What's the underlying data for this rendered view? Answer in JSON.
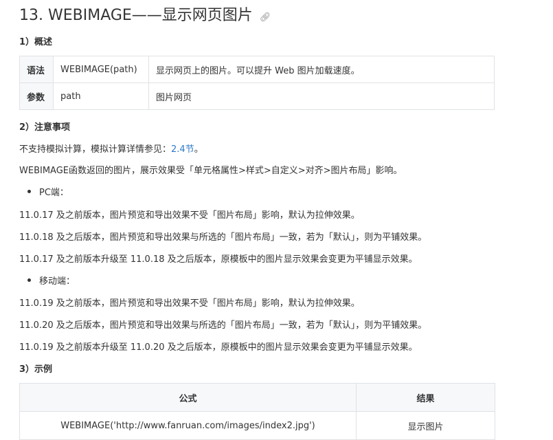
{
  "title": "13. WEBIMAGE——显示网页图片",
  "anchor_icon": "link-icon",
  "section1": {
    "heading": "1）概述",
    "rows": [
      {
        "key": "语法",
        "value": "WEBIMAGE(path)",
        "desc": "显示网页上的图片。可以提升 Web 图片加载速度。"
      },
      {
        "key": "参数",
        "value": "path",
        "desc": "图片网页"
      }
    ]
  },
  "section2": {
    "heading": "2）注意事项",
    "p1_text": "不支持模拟计算，模拟计算详情参见：",
    "p1_link": "2.4节",
    "p1_end": "。",
    "p2": "WEBIMAGE函数返回的图片，展示效果受「单元格属性>样式>自定义>对齐>图片布局」影响。",
    "pc_label": "PC端：",
    "pc_lines": [
      "11.0.17 及之前版本，图片预览和导出效果不受「图片布局」影响，默认为拉伸效果。",
      "11.0.18 及之后版本，图片预览和导出效果与所选的「图片布局」一致，若为「默认」，则为平铺效果。",
      "11.0.17 及之前版本升级至 11.0.18 及之后版本，原模板中的图片显示效果会变更为平铺显示效果。"
    ],
    "mobile_label": "移动端：",
    "mobile_lines": [
      "11.0.19 及之前版本，图片预览和导出效果不受「图片布局」影响，默认为拉伸效果。",
      "11.0.20 及之后版本，图片预览和导出效果与所选的「图片布局」一致，若为「默认」，则为平铺效果。",
      "11.0.19 及之前版本升级至 11.0.20 及之后版本，原模板中的图片显示效果会变更为平铺显示效果。"
    ]
  },
  "section3": {
    "heading": "3）示例",
    "col_formula": "公式",
    "col_result": "结果",
    "formula": "WEBIMAGE('http://www.fanruan.com/images/index2.jpg')",
    "result": "显示图片"
  },
  "colors": {
    "link": "#2e79c7",
    "border": "#dfe2e5",
    "header_bg": "#f6f8fa"
  }
}
